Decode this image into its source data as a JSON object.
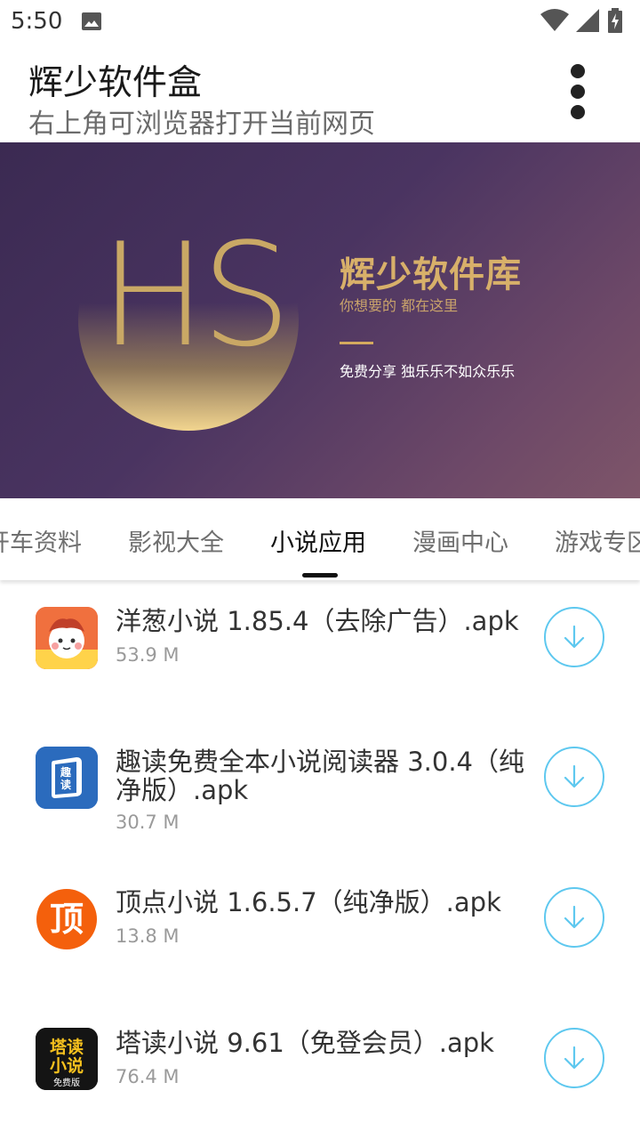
{
  "status_bar": {
    "time": "5:50",
    "icons": [
      "image-icon",
      "wifi-icon",
      "signal-icon",
      "battery-charging-icon"
    ]
  },
  "app_bar": {
    "title": "辉少软件盒",
    "subtitle": "右上角可浏览器打开当前网页",
    "menu_icon": "more-vert-icon"
  },
  "banner": {
    "logo": "HS",
    "title": "辉少软件库",
    "slogan": "你想要的 都在这里",
    "tagline": "免费分享 独乐乐不如众乐乐",
    "accent_color": "#d8b06a"
  },
  "tabs": [
    {
      "label": "开车资料",
      "active": false
    },
    {
      "label": "影视大全",
      "active": false
    },
    {
      "label": "小说应用",
      "active": true
    },
    {
      "label": "漫画中心",
      "active": false
    },
    {
      "label": "游戏专区",
      "active": false
    }
  ],
  "items": [
    {
      "name": "洋葱小说 1.85.4（去除广告）.apk",
      "size": "53.9 M",
      "icon": "onion-novel-app-icon"
    },
    {
      "name": "趣读免费全本小说阅读器 3.0.4（纯净版）.apk",
      "size": "30.7 M",
      "icon": "qudu-app-icon"
    },
    {
      "name": "顶点小说 1.6.5.7（纯净版）.apk",
      "size": "13.8 M",
      "icon": "dingdian-app-icon",
      "icon_text": "顶"
    },
    {
      "name": "塔读小说 9.61（免登会员）.apk",
      "size": "76.4 M",
      "icon": "tadu-app-icon",
      "icon_text": [
        "塔读",
        "小说",
        "免费版"
      ]
    }
  ],
  "colors": {
    "download_accent": "#5ec8ef",
    "tab_active": "#111111",
    "tab_inactive": "#6f6f6f"
  }
}
